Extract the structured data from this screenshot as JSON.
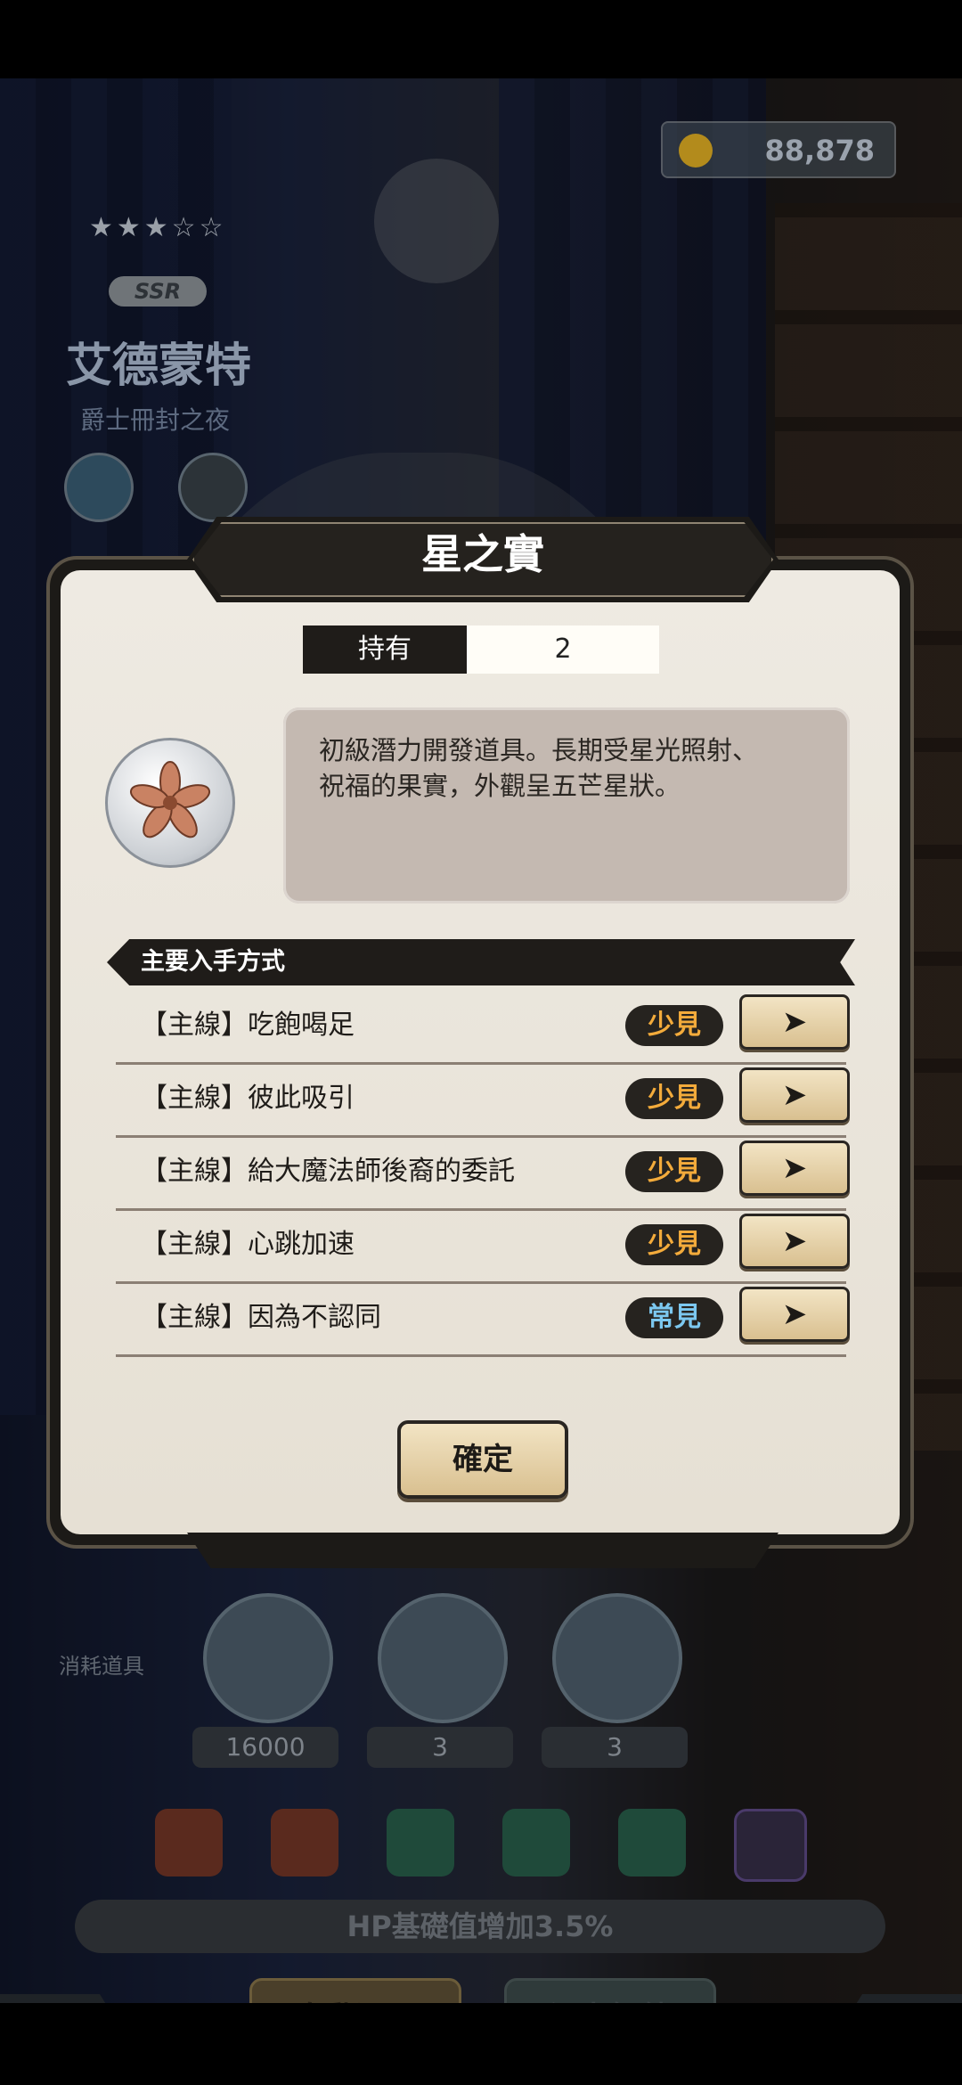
{
  "background": {
    "currency": "88,878",
    "rarity": "SSR",
    "character_name": "艾德蒙特",
    "character_subtitle": "爵士冊封之夜",
    "materials_label": "消耗道具",
    "material_counts": [
      "16000",
      "3",
      "3"
    ],
    "stat_bonus": "HP基礎值增加3.5%",
    "auto_select": "自動選取",
    "unlock": "潛力解鎖"
  },
  "dialog": {
    "title": "星之實",
    "owned_label": "持有",
    "owned_value": "2",
    "description": "初級潛力開發道具。長期受星光照射、\n祝福的果實，外觀呈五芒星狀。",
    "section_title": "主要入手方式",
    "sources": [
      {
        "label": "【主線】吃飽喝足",
        "rarity": "少見"
      },
      {
        "label": "【主線】彼此吸引",
        "rarity": "少見"
      },
      {
        "label": "【主線】給大魔法師後裔的委託",
        "rarity": "少見"
      },
      {
        "label": "【主線】心跳加速",
        "rarity": "少見"
      },
      {
        "label": "【主線】因為不認同",
        "rarity": "常見"
      }
    ],
    "go_icon": "play-arrow-icon",
    "confirm": "確定"
  },
  "colors": {
    "rare": "#f3ab3b",
    "common": "#7cc8f0",
    "button_gold": "#d9c090",
    "panel": "#eeeae2"
  }
}
